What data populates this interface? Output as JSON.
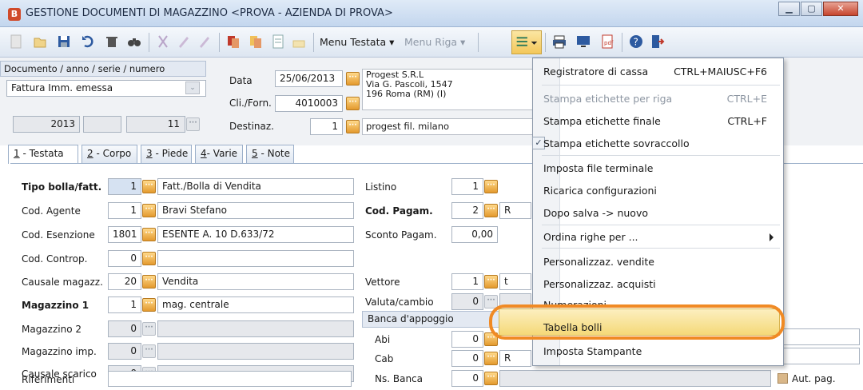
{
  "window": {
    "title": "GESTIONE DOCUMENTI DI MAGAZZINO <PROVA - AZIENDA DI PROVA>",
    "app_icon_letter": "B"
  },
  "toolbar": {
    "menu_testata": "Menu Testata",
    "menu_riga": "Menu Riga"
  },
  "header": {
    "doc_label": "Documento / anno / serie / numero",
    "doc_type": "Fattura Imm. emessa",
    "anno": "2013",
    "serie": "",
    "numero": "11",
    "data_label": "Data",
    "data_value": "25/06/2013",
    "cliforn_label": "Cli./Forn.",
    "cliforn_value": "4010003",
    "destinaz_label": "Destinaz.",
    "destinaz_value": "1",
    "company_name": "Progest S.R.L",
    "company_addr1": "Via G. Pascoli, 1547",
    "company_addr2": "196 Roma (RM)  (I)",
    "destinaz_name": "progest fil. milano"
  },
  "tabs": [
    {
      "num": "1",
      "label": " - Testata"
    },
    {
      "num": "2",
      "label": " - Corpo"
    },
    {
      "num": "3",
      "label": " - Piede"
    },
    {
      "num": "4",
      "label": "- Varie"
    },
    {
      "num": "5",
      "label": " - Note"
    }
  ],
  "form": {
    "tipo_bolla_label": "Tipo bolla/fatt.",
    "tipo_bolla_val": "1",
    "tipo_bolla_desc": "Fatt./Bolla di Vendita",
    "agente_label": "Cod. Agente",
    "agente_val": "1",
    "agente_desc": "Bravi Stefano",
    "esenzione_label": "Cod. Esenzione",
    "esenzione_val": "1801",
    "esenzione_desc": "ESENTE A. 10 D.633/72",
    "controp_label": "Cod. Controp.",
    "controp_val": "0",
    "causale_label": "Causale magazz.",
    "causale_val": "20",
    "causale_desc": "Vendita",
    "magazzino1_label": "Magazzino 1",
    "magazzino1_val": "1",
    "magazzino1_desc": "mag. centrale",
    "magazzino2_label": "Magazzino 2",
    "magazzino2_val": "0",
    "magimp_label": "Magazzino imp.",
    "magimp_val": "0",
    "scarico_label": "Causale scarico",
    "scarico_val": "0",
    "riferimenti_label": "Riferimenti",
    "listino_label": "Listino",
    "listino_val": "1",
    "pagam_label": "Cod. Pagam.",
    "pagam_val": "2",
    "pagam_desc": "R",
    "sconto_label": "Sconto Pagam.",
    "sconto_val": "0,00",
    "vettore_label": "Vettore",
    "vettore_val": "1",
    "vettore_desc": "t",
    "valuta_label": "Valuta/cambio",
    "valuta_val": "0",
    "banca_label": "Banca d'appoggio",
    "abi_label": "Abi",
    "abi_val": "0",
    "cab_label": "Cab",
    "cab_val": "0",
    "cab_desc": "R",
    "nsbanca_label": "Ns. Banca",
    "nsbanca_val": "0",
    "autpag_label": "Aut. pag."
  },
  "menu": {
    "items": [
      {
        "label": "Registratore di cassa",
        "shortcut": "CTRL+MAIUSC+F6"
      },
      {
        "label": "Stampa etichette per riga",
        "shortcut": "CTRL+E"
      },
      {
        "label": "Stampa etichette finale",
        "shortcut": "CTRL+F"
      },
      {
        "label": "Stampa etichette sovraccollo",
        "shortcut": ""
      },
      {
        "label": "Imposta file terminale",
        "shortcut": ""
      },
      {
        "label": "Ricarica configurazioni",
        "shortcut": ""
      },
      {
        "label": "Dopo salva -> nuovo",
        "shortcut": ""
      },
      {
        "label": "Ordina righe per ...",
        "shortcut": ""
      },
      {
        "label": "Personalizzaz. vendite",
        "shortcut": ""
      },
      {
        "label": "Personalizzaz. acquisti",
        "shortcut": ""
      },
      {
        "label": "Numerazioni",
        "shortcut": ""
      },
      {
        "label": "Tabella bolli",
        "shortcut": ""
      },
      {
        "label": "Imposta Stampante",
        "shortcut": ""
      }
    ]
  },
  "colors": {
    "highlight_ring": "#f08a24",
    "menu_hover": "#f5d978"
  }
}
